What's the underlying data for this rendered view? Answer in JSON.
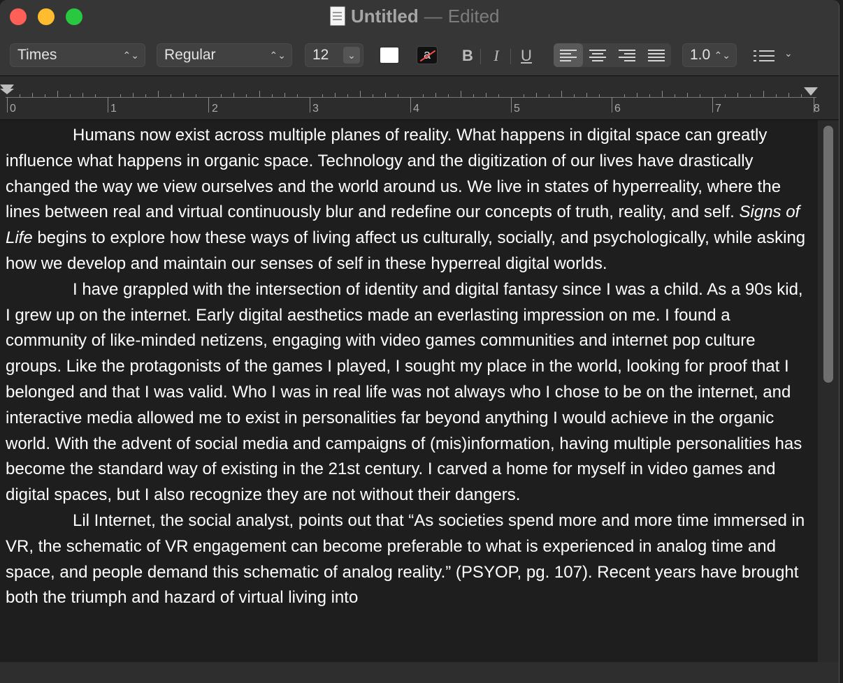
{
  "window": {
    "title": "Untitled",
    "separator": "—",
    "status": "Edited"
  },
  "toolbar": {
    "font_family": "Times",
    "font_style": "Regular",
    "font_size": "12",
    "bold_label": "B",
    "italic_label": "I",
    "underline_label": "U",
    "line_spacing": "1.0",
    "bg_color_glyph": "a",
    "text_color": "#ffffff",
    "background_color": "#000000",
    "active_alignment": "left"
  },
  "ruler": {
    "numbers": [
      "0",
      "1",
      "2",
      "3",
      "4",
      "5",
      "6",
      "7",
      "8"
    ]
  },
  "document": {
    "paragraphs": [
      {
        "before": "Humans now exist across multiple planes of reality. What happens in digital space can greatly influence what happens in organic space.  Technology and the digitization of our lives have drastically changed the way we view ourselves and the world around us. We live in states of hyperreality, where the lines between real and virtual continuously blur and redefine our concepts of truth, reality, and self. ",
        "italic": "Signs of Life",
        "after": " begins to explore how these ways of living affect us culturally, socially, and psychologically, while asking how we develop and maintain our senses of self in these hyperreal digital worlds."
      },
      {
        "text": "I have grappled with the intersection of identity and digital fantasy since I was a child. As a 90s kid, I grew up on the internet. Early digital aesthetics made an everlasting impression on me. I found a community of like-minded netizens, engaging with video games communities and internet pop culture groups. Like the protagonists of the games I played, I sought my place in the world, looking for proof that I belonged and that I was valid. Who I was in real life was not always who I chose to be on the internet, and interactive media allowed me to exist in personalities far beyond anything I would achieve in the organic world. With the advent of social media and campaigns of (mis)information, having multiple personalities has become the standard way of existing in the 21st century. I carved a home for myself in video games and digital spaces, but I also recognize they are not without their dangers."
      },
      {
        "text": "Lil Internet, the social analyst, points out that “As societies spend more and more time immersed in VR, the schematic of VR engagement can become preferable to what is experienced in analog time and space, and people demand this schematic of analog reality.” (PSYOP, pg. 107). Recent years have brought both the triumph and hazard of virtual living into"
      }
    ]
  },
  "icons": {
    "document": "document-icon",
    "list": "list-bullets-icon",
    "stepper": "up-down-chevron-icon"
  }
}
